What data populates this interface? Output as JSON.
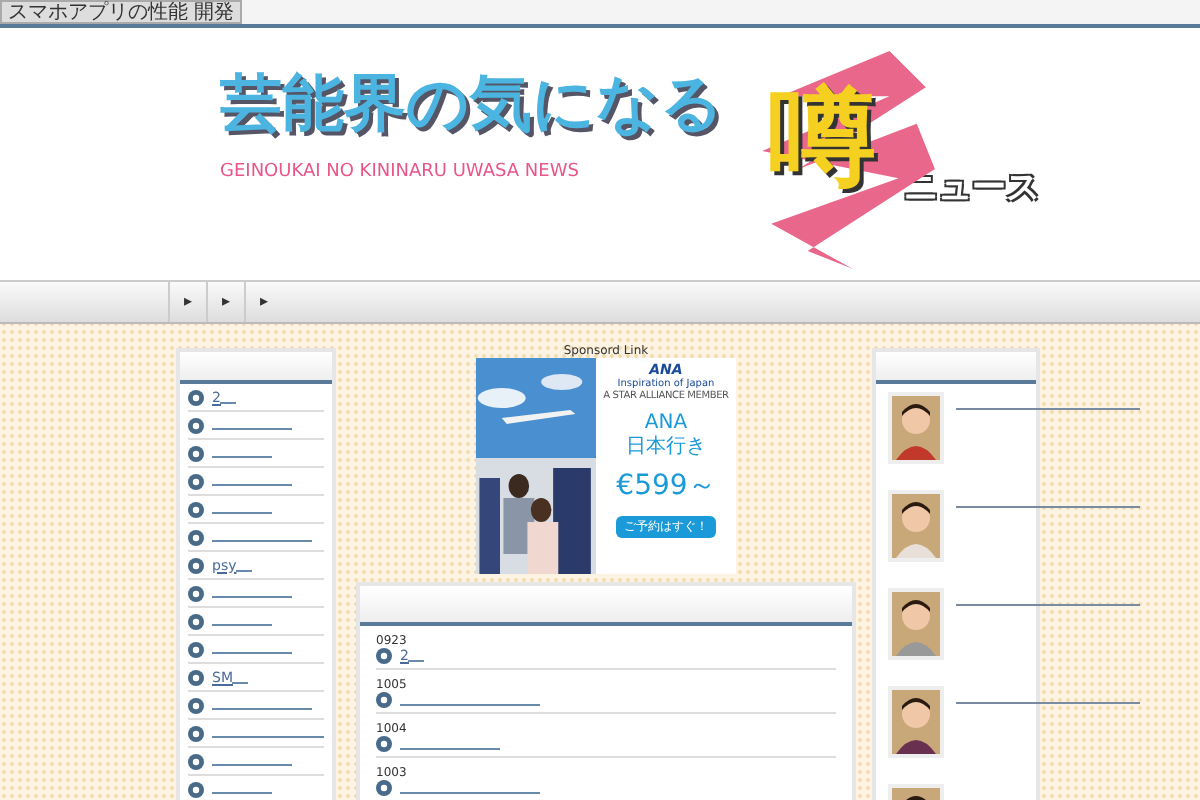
{
  "top_bar": {
    "label": "スマホアプリの性能 開発"
  },
  "header": {
    "logo_title": "芸能界の気になる",
    "logo_big": "噂",
    "logo_suffix": "ニュース",
    "logo_subtitle": "GEINOUKAI NO KININARU UWASA NEWS"
  },
  "nav": {
    "items": [
      "▸",
      "▸",
      "▸"
    ]
  },
  "left_sidebar": {
    "items": [
      {
        "kind": "link",
        "text": "2"
      },
      {
        "kind": "blank"
      },
      {
        "kind": "blank"
      },
      {
        "kind": "blank"
      },
      {
        "kind": "blank"
      },
      {
        "kind": "blank"
      },
      {
        "kind": "link",
        "text": "psy"
      },
      {
        "kind": "blank"
      },
      {
        "kind": "blank"
      },
      {
        "kind": "blank"
      },
      {
        "kind": "link",
        "text": "SM"
      },
      {
        "kind": "blank"
      },
      {
        "kind": "blank"
      },
      {
        "kind": "blank"
      },
      {
        "kind": "blank"
      }
    ]
  },
  "sponsor": {
    "label": "Sponsord Link",
    "ad": {
      "brand": "ANA",
      "tagline": "Inspiration of Japan",
      "alliance": "A STAR ALLIANCE MEMBER",
      "headline": "ANA\n日本行き",
      "price": "€599～",
      "cta": "ご予約はすぐ！"
    }
  },
  "posts": [
    {
      "date": "0923",
      "kind": "link",
      "text": "2"
    },
    {
      "date": "1005",
      "kind": "blank"
    },
    {
      "date": "1004",
      "kind": "blank"
    },
    {
      "date": "1003",
      "kind": "blank"
    }
  ]
}
